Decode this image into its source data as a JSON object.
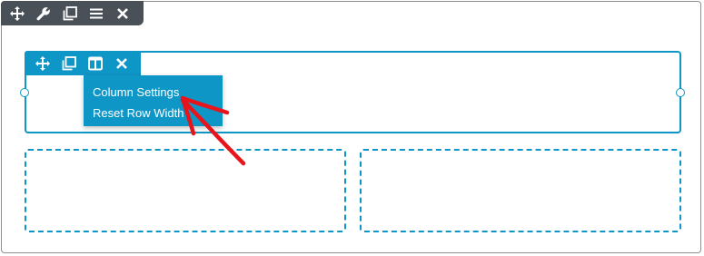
{
  "main_toolbar": {
    "icons": [
      "move-icon",
      "wrench-icon",
      "duplicate-icon",
      "menu-icon",
      "close-icon"
    ]
  },
  "row_toolbar": {
    "icons": [
      "move-icon",
      "duplicate-icon",
      "columns-icon",
      "close-icon"
    ]
  },
  "column_menu": {
    "items": [
      {
        "label": "Column Settings"
      },
      {
        "label": "Reset Row Width"
      }
    ]
  },
  "colors": {
    "accent": "#0e96c7",
    "toolbar_dark": "#4a5058",
    "annotation_arrow": "#e8141c"
  }
}
